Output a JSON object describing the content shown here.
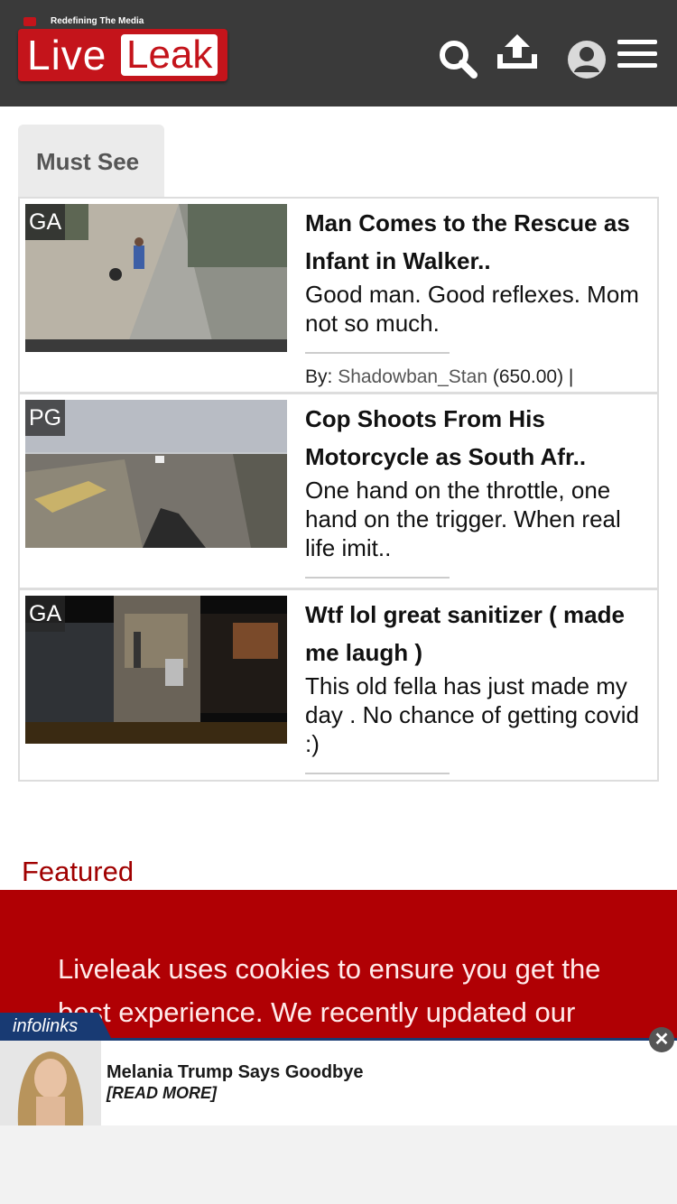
{
  "header": {
    "logo": {
      "tagline": "Redefining The Media",
      "word1": "Live",
      "word2": "Leak"
    },
    "icons": [
      "search-icon",
      "upload-icon",
      "user-icon",
      "menu-icon"
    ]
  },
  "tabs": [
    {
      "label": "Must See",
      "active": true
    }
  ],
  "videos": [
    {
      "rating": "GA",
      "title": "Man Comes to the Rescue as Infant in Walker..",
      "description": "Good man. Good reflexes. Mom not so much.",
      "by_label": "By:",
      "user": "Shadowban_Stan",
      "score": "(650.00) |"
    },
    {
      "rating": "PG",
      "title": "Cop Shoots From His Motorcycle as South Afr..",
      "description": "One hand on the throttle, one hand on the trigger. When real life imit.."
    },
    {
      "rating": "GA",
      "title": "Wtf lol great sanitizer ( made me laugh )",
      "description": "This old fella has just made my day . No chance of getting covid :)"
    }
  ],
  "featured": {
    "label": "Featured"
  },
  "cookie": {
    "text": "Liveleak uses cookies to ensure you get the best experience. We recently updated our"
  },
  "ad": {
    "brand": "infolinks",
    "title": "Melania Trump Says Goodbye",
    "cta": "[READ MORE]",
    "close": "✕"
  },
  "colors": {
    "header_bg": "#3a3a3a",
    "brand_red": "#c4141b",
    "cookie_bg": "#b00004",
    "featured": "#a00000",
    "ad_blue": "#183a73"
  }
}
